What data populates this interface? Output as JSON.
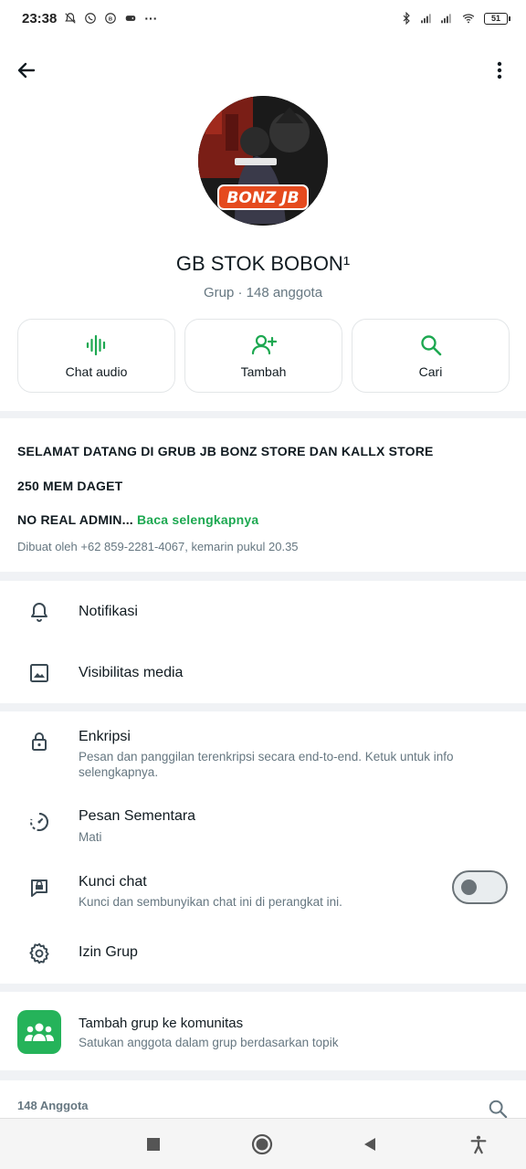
{
  "status_bar": {
    "time": "23:38",
    "battery": "51",
    "icons": [
      "mute-icon",
      "whatsapp-icon",
      "b-icon",
      "game-icon",
      "more-icon",
      "bluetooth-icon",
      "signal-icon",
      "signal-icon",
      "wifi-icon"
    ]
  },
  "header": {
    "back_icon": "arrow-left-icon",
    "menu_icon": "more-vert-icon",
    "group_name": "GB STOK BOBON¹",
    "group_sub": "Grup · 148 anggota",
    "avatar_text": "BONZ JB"
  },
  "actions": [
    {
      "label": "Chat audio",
      "icon": "audio-wave-icon"
    },
    {
      "label": "Tambah",
      "icon": "add-person-icon"
    },
    {
      "label": "Cari",
      "icon": "search-icon"
    }
  ],
  "description": {
    "line1": "SELAMAT DATANG DI GRUB JB BONZ STORE DAN KALLX STORE",
    "line2": "250 MEM DAGET",
    "line3": "NO REAL ADMIN...",
    "read_more": "Baca selengkapnya",
    "created": "Dibuat oleh +62 859-2281-4067, kemarin pukul 20.35"
  },
  "settings_a": [
    {
      "title": "Notifikasi",
      "icon": "bell-icon"
    },
    {
      "title": "Visibilitas media",
      "icon": "image-icon"
    }
  ],
  "settings_b": {
    "encryption": {
      "title": "Enkripsi",
      "sub": "Pesan dan panggilan terenkripsi secara end-to-end. Ketuk untuk info selengkapnya.",
      "icon": "lock-icon"
    },
    "disappearing": {
      "title": "Pesan Sementara",
      "sub": "Mati",
      "icon": "timer-icon"
    },
    "chat_lock": {
      "title": "Kunci chat",
      "sub": "Kunci dan sembunyikan chat ini di perangkat ini.",
      "icon": "chat-lock-icon",
      "enabled": false
    },
    "permissions": {
      "title": "Izin Grup",
      "icon": "gear-icon"
    }
  },
  "community": {
    "title": "Tambah grup ke komunitas",
    "sub": "Satukan anggota dalam grup berdasarkan topik",
    "icon": "community-icon"
  },
  "members": {
    "count": "148 Anggota",
    "search_icon": "search-icon"
  },
  "navbar": [
    "recents-icon",
    "home-icon",
    "back-icon",
    "accessibility-icon"
  ],
  "colors": {
    "accent": "#1da851",
    "community_bg": "#25b35a",
    "text_primary": "#111b21",
    "text_secondary": "#667781",
    "background": "#f0f2f5"
  }
}
